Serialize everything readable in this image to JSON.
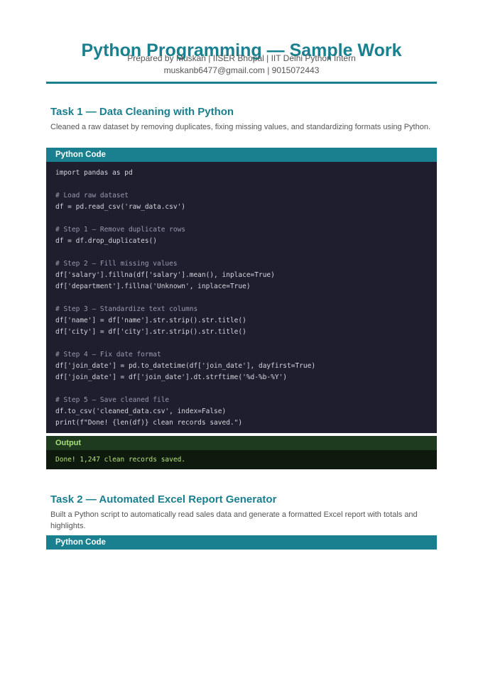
{
  "header": {
    "title": "Python Programming — Sample Work",
    "subtitle": "Prepared by Muskan | IISER Bhopal | IIT Delhi Python Intern",
    "contact": "muskanb6477@gmail.com | 9015072443"
  },
  "task1": {
    "title": "Task 1 — Data Cleaning with Python",
    "description": "Cleaned a raw dataset by removing duplicates, fixing missing values, and standardizing formats using Python.",
    "code_label": "Python Code",
    "code_lines": [
      "import pandas as pd",
      "",
      "# Load raw dataset",
      "df = pd.read_csv('raw_data.csv')",
      "",
      "# Step 1 — Remove duplicate rows",
      "df = df.drop_duplicates()",
      "",
      "# Step 2 — Fill missing values",
      "df['salary'].fillna(df['salary'].mean(), inplace=True)",
      "df['department'].fillna('Unknown', inplace=True)",
      "",
      "# Step 3 — Standardize text columns",
      "df['name'] = df['name'].str.strip().str.title()",
      "df['city'] = df['city'].str.strip().str.title()",
      "",
      "# Step 4 — Fix date format",
      "df['join_date'] = pd.to_datetime(df['join_date'], dayfirst=True)",
      "df['join_date'] = df['join_date'].dt.strftime('%d-%b-%Y')",
      "",
      "# Step 5 — Save cleaned file",
      "df.to_csv('cleaned_data.csv', index=False)",
      "print(f\"Done! {len(df)} clean records saved.\")"
    ],
    "output_label": "Output",
    "output_text": "Done! 1,247 clean records saved."
  },
  "task2": {
    "title": "Task 2 — Automated Excel Report Generator",
    "description": "Built a Python script to automatically read sales data and generate a formatted Excel report with totals and highlights.",
    "code_label": "Python Code"
  }
}
